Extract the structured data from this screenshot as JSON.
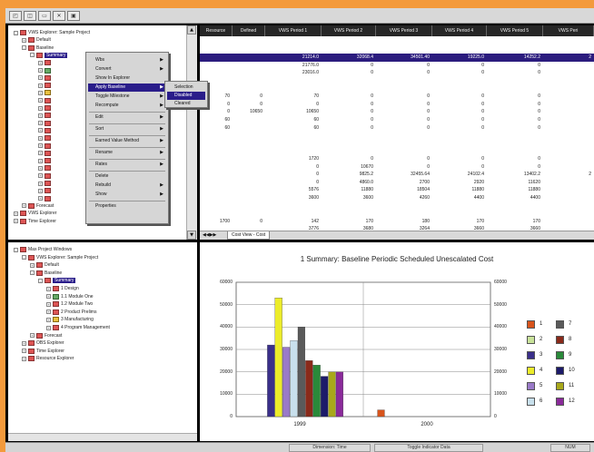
{
  "toolbar": {
    "buttons": [
      "◰",
      "◫",
      "▭",
      "✕",
      "▣"
    ]
  },
  "tree_top": {
    "items": [
      {
        "depth": 0,
        "exp": "-",
        "icon": "r",
        "label": "VWS Explorer: Sample Project",
        "sel": false
      },
      {
        "depth": 1,
        "exp": "+",
        "icon": "r",
        "label": "Default",
        "sel": false
      },
      {
        "depth": 1,
        "exp": "-",
        "icon": "r",
        "label": "Baseline",
        "sel": false
      },
      {
        "depth": 2,
        "exp": "-",
        "icon": "r",
        "label": "Summary",
        "sel": true
      },
      {
        "depth": 3,
        "exp": "+",
        "icon": "r",
        "label": "",
        "sel": false
      },
      {
        "depth": 3,
        "exp": "+",
        "icon": "g",
        "label": "",
        "sel": false
      },
      {
        "depth": 3,
        "exp": "+",
        "icon": "r",
        "label": "",
        "sel": false
      },
      {
        "depth": 3,
        "exp": "+",
        "icon": "r",
        "label": "",
        "sel": false
      },
      {
        "depth": 3,
        "exp": "+",
        "icon": "y",
        "label": "",
        "sel": false
      },
      {
        "depth": 3,
        "exp": "+",
        "icon": "r",
        "label": "",
        "sel": false
      },
      {
        "depth": 3,
        "exp": "+",
        "icon": "r",
        "label": "",
        "sel": false
      },
      {
        "depth": 3,
        "exp": "+",
        "icon": "r",
        "label": "",
        "sel": false
      },
      {
        "depth": 3,
        "exp": "+",
        "icon": "r",
        "label": "",
        "sel": false
      },
      {
        "depth": 3,
        "exp": "+",
        "icon": "r",
        "label": "",
        "sel": false
      },
      {
        "depth": 3,
        "exp": "+",
        "icon": "r",
        "label": "",
        "sel": false
      },
      {
        "depth": 3,
        "exp": "+",
        "icon": "r",
        "label": "",
        "sel": false
      },
      {
        "depth": 3,
        "exp": "+",
        "icon": "r",
        "label": "",
        "sel": false
      },
      {
        "depth": 3,
        "exp": "+",
        "icon": "r",
        "label": "",
        "sel": false
      },
      {
        "depth": 3,
        "exp": "+",
        "icon": "r",
        "label": "",
        "sel": false
      },
      {
        "depth": 3,
        "exp": "+",
        "icon": "r",
        "label": "",
        "sel": false
      },
      {
        "depth": 3,
        "exp": "+",
        "icon": "r",
        "label": "",
        "sel": false
      },
      {
        "depth": 3,
        "exp": "+",
        "icon": "r",
        "label": "",
        "sel": false
      },
      {
        "depth": 3,
        "exp": "+",
        "icon": "r",
        "label": "",
        "sel": false
      },
      {
        "depth": 1,
        "exp": "+",
        "icon": "r",
        "label": "Forecast",
        "sel": false
      },
      {
        "depth": 0,
        "exp": "+",
        "icon": "r",
        "label": "VWS Explorer",
        "sel": false
      },
      {
        "depth": 0,
        "exp": "+",
        "icon": "r",
        "label": "Time Explorer",
        "sel": false
      }
    ]
  },
  "context_menu": {
    "items": [
      {
        "label": "Wbs",
        "arrow": true,
        "sel": false,
        "sep_after": false
      },
      {
        "label": "Convert",
        "arrow": true,
        "sel": false,
        "sep_after": false
      },
      {
        "label": "Show In Explorer",
        "arrow": false,
        "sel": false,
        "sep_after": false
      },
      {
        "label": "Apply Baseline",
        "arrow": true,
        "sel": true,
        "sep_after": false
      },
      {
        "label": "Toggle Milestone",
        "arrow": true,
        "sel": false,
        "sep_after": false
      },
      {
        "label": "Recompute",
        "arrow": true,
        "sel": false,
        "sep_after": true
      },
      {
        "label": "Edit",
        "arrow": true,
        "sel": false,
        "sep_after": true
      },
      {
        "label": "Sort",
        "arrow": true,
        "sel": false,
        "sep_after": true
      },
      {
        "label": "Earned Value Method",
        "arrow": true,
        "sel": false,
        "sep_after": true
      },
      {
        "label": "Rename",
        "arrow": true,
        "sel": false,
        "sep_after": true
      },
      {
        "label": "Rates",
        "arrow": true,
        "sel": false,
        "sep_after": true
      },
      {
        "label": "Delete",
        "arrow": false,
        "sel": false,
        "sep_after": false
      },
      {
        "label": "Rebuild",
        "arrow": true,
        "sel": false,
        "sep_after": false
      },
      {
        "label": "Show",
        "arrow": true,
        "sel": false,
        "sep_after": true
      },
      {
        "label": "Properties",
        "arrow": false,
        "sel": false,
        "sep_after": false
      }
    ]
  },
  "submenu": {
    "items": [
      {
        "label": "Selection",
        "sel": false
      },
      {
        "label": "Disabled",
        "sel": true
      },
      {
        "label": "Cleared",
        "sel": false
      }
    ]
  },
  "grid": {
    "columns": [
      "Resource",
      "Defined",
      "VWS Period 1",
      "VWS Period 2",
      "VWS Period 3",
      "VWS Period 4",
      "VWS Period 5",
      "VWS Peri"
    ],
    "rows": [
      {
        "hl": false,
        "cells": [
          "",
          "",
          "",
          "",
          "",
          "",
          "",
          ""
        ]
      },
      {
        "hl": false,
        "cells": [
          "",
          "",
          "",
          "",
          "",
          "",
          "",
          ""
        ]
      },
      {
        "hl": true,
        "cells": [
          "",
          "",
          "21214.0",
          "32068.4",
          "34501.40",
          "19225.0",
          "14252.2",
          "2"
        ]
      },
      {
        "hl": false,
        "cells": [
          "",
          "",
          "21776.0",
          "0",
          "0",
          "0",
          "0",
          ""
        ]
      },
      {
        "hl": false,
        "cells": [
          "",
          "",
          "23016.0",
          "0",
          "0",
          "0",
          "0",
          ""
        ]
      },
      {
        "hl": false,
        "cells": [
          "",
          "",
          "",
          "",
          "",
          "",
          "",
          ""
        ]
      },
      {
        "hl": false,
        "cells": [
          "",
          "",
          "",
          "",
          "",
          "",
          "",
          ""
        ]
      },
      {
        "hl": false,
        "cells": [
          "70",
          "0",
          "70",
          "0",
          "0",
          "0",
          "0",
          ""
        ]
      },
      {
        "hl": false,
        "cells": [
          "0",
          "0",
          "0",
          "0",
          "0",
          "0",
          "0",
          ""
        ]
      },
      {
        "hl": false,
        "cells": [
          "0",
          "10650",
          "10650",
          "0",
          "0",
          "0",
          "0",
          ""
        ]
      },
      {
        "hl": false,
        "cells": [
          "60",
          "",
          "60",
          "0",
          "0",
          "0",
          "0",
          ""
        ]
      },
      {
        "hl": false,
        "cells": [
          "60",
          "",
          "60",
          "0",
          "0",
          "0",
          "0",
          ""
        ]
      },
      {
        "hl": false,
        "cells": [
          "",
          "",
          "",
          "",
          "",
          "",
          "",
          ""
        ]
      },
      {
        "hl": false,
        "cells": [
          "",
          "",
          "",
          "",
          "",
          "",
          "",
          ""
        ]
      },
      {
        "hl": false,
        "cells": [
          "",
          "",
          "",
          "",
          "",
          "",
          "",
          ""
        ]
      },
      {
        "hl": false,
        "cells": [
          "",
          "",
          "1720",
          "0",
          "0",
          "0",
          "0",
          ""
        ]
      },
      {
        "hl": false,
        "cells": [
          "",
          "",
          "0",
          "10670",
          "0",
          "0",
          "0",
          ""
        ]
      },
      {
        "hl": false,
        "cells": [
          "",
          "",
          "0",
          "9825.2",
          "32455.64",
          "24102.4",
          "13402.2",
          "2"
        ]
      },
      {
        "hl": false,
        "cells": [
          "",
          "",
          "0",
          "4860.0",
          "2700",
          "2920",
          "11620",
          ""
        ]
      },
      {
        "hl": false,
        "cells": [
          "",
          "",
          "5576",
          "11880",
          "18504",
          "11880",
          "11880",
          ""
        ]
      },
      {
        "hl": false,
        "cells": [
          "",
          "",
          "3600",
          "3600",
          "4260",
          "4400",
          "4400",
          ""
        ]
      },
      {
        "hl": false,
        "cells": [
          "",
          "",
          "",
          "",
          "",
          "",
          "",
          ""
        ]
      },
      {
        "hl": false,
        "cells": [
          "",
          "",
          "",
          "",
          "",
          "",
          "",
          ""
        ]
      },
      {
        "hl": false,
        "cells": [
          "1700",
          "0",
          "142",
          "170",
          "180",
          "170",
          "170",
          ""
        ]
      },
      {
        "hl": false,
        "cells": [
          "",
          "",
          "3776",
          "3680",
          "3264",
          "3660",
          "3660",
          ""
        ]
      }
    ]
  },
  "tabbar": {
    "tab_label": "Cost View - Cost"
  },
  "tree_bottom": {
    "items": [
      {
        "depth": 0,
        "exp": "-",
        "icon": "r",
        "label": "Max Project Windows",
        "sel": false
      },
      {
        "depth": 1,
        "exp": "-",
        "icon": "r",
        "label": "VWS Explorer: Sample Project",
        "sel": false
      },
      {
        "depth": 2,
        "exp": "+",
        "icon": "r",
        "label": "Default",
        "sel": false
      },
      {
        "depth": 2,
        "exp": "-",
        "icon": "r",
        "label": "Baseline",
        "sel": false
      },
      {
        "depth": 3,
        "exp": "-",
        "icon": "r",
        "label": "Summary",
        "sel": true
      },
      {
        "depth": 4,
        "exp": "+",
        "icon": "r",
        "label": "1 Design",
        "sel": false
      },
      {
        "depth": 4,
        "exp": "+",
        "icon": "g",
        "label": "1.1 Module One",
        "sel": false
      },
      {
        "depth": 4,
        "exp": "+",
        "icon": "r",
        "label": "1.2 Module Two",
        "sel": false
      },
      {
        "depth": 4,
        "exp": "+",
        "icon": "r",
        "label": "2 Product Prelims",
        "sel": false
      },
      {
        "depth": 4,
        "exp": "+",
        "icon": "y",
        "label": "3 Manufacturing",
        "sel": false
      },
      {
        "depth": 4,
        "exp": "+",
        "icon": "r",
        "label": "4 Program Management",
        "sel": false
      },
      {
        "depth": 2,
        "exp": "+",
        "icon": "r",
        "label": "Forecast",
        "sel": false
      },
      {
        "depth": 1,
        "exp": "+",
        "icon": "r",
        "label": "OBS Explorer",
        "sel": false
      },
      {
        "depth": 1,
        "exp": "+",
        "icon": "r",
        "label": "Time Explorer",
        "sel": false
      },
      {
        "depth": 1,
        "exp": "+",
        "icon": "r",
        "label": "Resource Explorer",
        "sel": false
      }
    ]
  },
  "status": {
    "fields": [
      "Dimension: Time",
      "Toggle Indicator Data",
      "NUM"
    ]
  },
  "chart_data": {
    "type": "bar",
    "title": "1 Summary: Baseline Periodic Scheduled Unescalated Cost",
    "categories": [
      "1999",
      "2000"
    ],
    "ylim": [
      0,
      60000
    ],
    "yticks": [
      0,
      10000,
      20000,
      30000,
      40000,
      50000,
      60000
    ],
    "grid": true,
    "legend_placement": "right",
    "series": [
      {
        "name": "1",
        "color": "#d8541c",
        "values": [
          0,
          3000
        ]
      },
      {
        "name": "2",
        "color": "#c9e39a",
        "values": [
          0,
          0
        ]
      },
      {
        "name": "3",
        "color": "#3a2f8a",
        "values": [
          32000,
          0
        ]
      },
      {
        "name": "4",
        "color": "#ecec2a",
        "values": [
          53000,
          0
        ]
      },
      {
        "name": "5",
        "color": "#9a7ac8",
        "values": [
          31000,
          0
        ]
      },
      {
        "name": "6",
        "color": "#c8e0ec",
        "values": [
          34000,
          0
        ]
      },
      {
        "name": "7",
        "color": "#5a5a5a",
        "values": [
          40000,
          0
        ]
      },
      {
        "name": "8",
        "color": "#8a2a1a",
        "values": [
          25000,
          0
        ]
      },
      {
        "name": "9",
        "color": "#2a8a3a",
        "values": [
          23000,
          0
        ]
      },
      {
        "name": "10",
        "color": "#1c1a6a",
        "values": [
          18000,
          0
        ]
      },
      {
        "name": "11",
        "color": "#a8a81a",
        "values": [
          20000,
          0
        ]
      },
      {
        "name": "12",
        "color": "#8a2a9a",
        "values": [
          20000,
          0
        ]
      }
    ]
  }
}
